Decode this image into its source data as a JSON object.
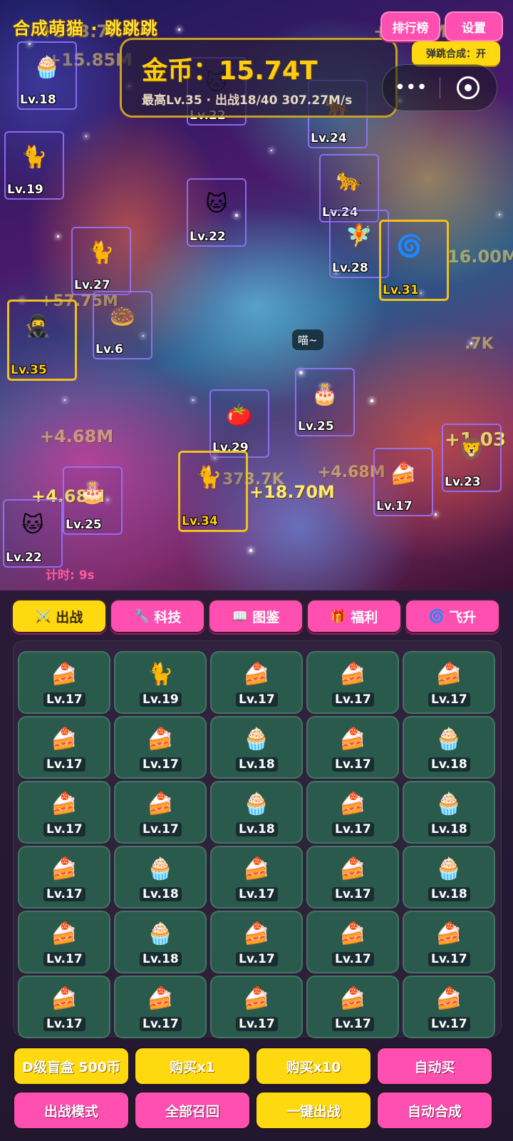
{
  "game_title": "合成萌猫 · 跳跳跳",
  "header": {
    "leaderboard_label": "排行榜",
    "settings_label": "设置",
    "bounce_merge_toggle": "弹跳合成：开"
  },
  "coin_panel": {
    "coins_label": "金币：15.74T",
    "stats_text": "最高Lv.35 · 出战18/40  307.27M/s"
  },
  "floating_texts": [
    {
      "text": "+303.7K",
      "faint": true
    },
    {
      "text": "+15.85M",
      "faint": true
    },
    {
      "text": "+1.87M",
      "faint": true
    },
    {
      "text": "16.00M",
      "faint": true
    },
    {
      "text": "+57.75M",
      "faint": true
    },
    {
      "text": "+4.68M",
      "faint": true
    },
    {
      "text": "+1.03",
      "faint": false
    },
    {
      "text": "373.7K",
      "faint": true
    },
    {
      "text": "+4.68M",
      "faint": true
    },
    {
      "text": "+18.70M",
      "faint": false
    },
    {
      "text": "+4.68M",
      "faint": false
    },
    {
      "text": ".7K",
      "faint": true
    }
  ],
  "speech_bubble": "喵~",
  "timer_text": "计时: 9s",
  "field_cats": [
    {
      "level": "Lv.18",
      "icon": "cupcake-cat",
      "glyph": "🧁",
      "gold": false
    },
    {
      "level": "Lv.22",
      "icon": "green-cat",
      "glyph": "🐱",
      "gold": false
    },
    {
      "level": "Lv.24",
      "icon": "leopard-cat",
      "glyph": "🐆",
      "gold": false
    },
    {
      "level": "Lv.19",
      "icon": "orange-cat",
      "glyph": "🐈",
      "gold": false
    },
    {
      "level": "Lv.22",
      "icon": "green-cat",
      "glyph": "🐱",
      "gold": false
    },
    {
      "level": "Lv.24",
      "icon": "leopard-cat",
      "glyph": "🐆",
      "gold": false
    },
    {
      "level": "Lv.28",
      "icon": "fairy-cat",
      "glyph": "🧚",
      "gold": false
    },
    {
      "level": "Lv.31",
      "icon": "galaxy-cat",
      "glyph": "🌀",
      "gold": true
    },
    {
      "level": "Lv.27",
      "icon": "golden-cat",
      "glyph": "🐈",
      "gold": false
    },
    {
      "level": "Lv.6",
      "icon": "donut-cat",
      "glyph": "🍩",
      "gold": false
    },
    {
      "level": "Lv.35",
      "icon": "warrior-cat",
      "glyph": "🥷",
      "gold": true
    },
    {
      "level": "Lv.25",
      "icon": "cake-cat",
      "glyph": "🎂",
      "gold": false
    },
    {
      "level": "Lv.29",
      "icon": "tomato-cat",
      "glyph": "🍅",
      "gold": false
    },
    {
      "level": "Lv.23",
      "icon": "gold-cat",
      "glyph": "🦁",
      "gold": false
    },
    {
      "level": "Lv.17",
      "icon": "tiramisu-cat",
      "glyph": "🍰",
      "gold": false
    },
    {
      "level": "Lv.34",
      "icon": "crystal-cat",
      "glyph": "🐈",
      "gold": true
    },
    {
      "level": "Lv.25",
      "icon": "cake-cat",
      "glyph": "🎂",
      "gold": false
    },
    {
      "level": "Lv.22",
      "icon": "green-cat",
      "glyph": "🐱",
      "gold": false
    }
  ],
  "tabs": [
    {
      "label": "出战",
      "icon": "swords-icon",
      "glyph": "⚔️",
      "active": true
    },
    {
      "label": "科技",
      "icon": "wrench-icon",
      "glyph": "🔧",
      "active": false
    },
    {
      "label": "图鉴",
      "icon": "book-icon",
      "glyph": "📖",
      "active": false
    },
    {
      "label": "福利",
      "icon": "gift-icon",
      "glyph": "🎁",
      "active": false
    },
    {
      "label": "飞升",
      "icon": "swirl-icon",
      "glyph": "🌀",
      "active": false
    }
  ],
  "inventory": [
    [
      "Lv.17",
      "Lv.19",
      "Lv.17",
      "Lv.17",
      "Lv.17"
    ],
    [
      "Lv.17",
      "Lv.17",
      "Lv.18",
      "Lv.17",
      "Lv.18"
    ],
    [
      "Lv.17",
      "Lv.17",
      "Lv.18",
      "Lv.17",
      "Lv.18"
    ],
    [
      "Lv.17",
      "Lv.18",
      "Lv.17",
      "Lv.17",
      "Lv.18"
    ],
    [
      "Lv.17",
      "Lv.18",
      "Lv.17",
      "Lv.17",
      "Lv.17"
    ],
    [
      "Lv.17",
      "Lv.17",
      "Lv.17",
      "Lv.17",
      "Lv.17"
    ]
  ],
  "inventory_glyphs": {
    "Lv.17": "🍰",
    "Lv.18": "🧁",
    "Lv.19": "🐈"
  },
  "actions": [
    {
      "label": "D级盲盒 500币",
      "color": "yellow"
    },
    {
      "label": "购买x1",
      "color": "yellow"
    },
    {
      "label": "购买x10",
      "color": "yellow"
    },
    {
      "label": "自动买",
      "color": "pink"
    },
    {
      "label": "出战模式",
      "color": "pink"
    },
    {
      "label": "全部召回",
      "color": "pink"
    },
    {
      "label": "一键出战",
      "color": "yellow"
    },
    {
      "label": "自动合成",
      "color": "pink"
    }
  ]
}
